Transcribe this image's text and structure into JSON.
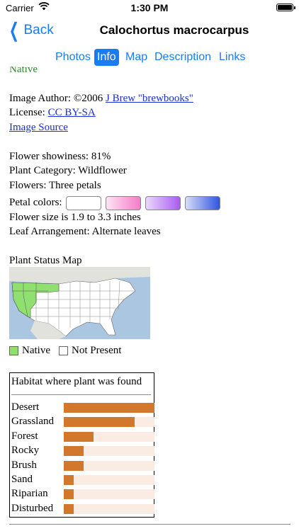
{
  "status_bar": {
    "carrier": "Carrier",
    "time": "1:30 PM"
  },
  "nav": {
    "back_label": "Back",
    "title": "Calochortus macrocarpus"
  },
  "tabs": [
    {
      "label": "Photos",
      "active": false
    },
    {
      "label": "Info",
      "active": true
    },
    {
      "label": "Map",
      "active": false
    },
    {
      "label": "Description",
      "active": false
    },
    {
      "label": "Links",
      "active": false
    }
  ],
  "info": {
    "native_partial": "Native",
    "author_label": "Image Author: ",
    "author_year": "©2006 ",
    "author_link": "J Brew \"brewbooks\"",
    "license_label": "License: ",
    "license_link": "CC BY-SA",
    "image_source": "Image Source",
    "showiness": "Flower showiness: 81%",
    "category": "Plant Category: Wildflower",
    "flowers": "Flowers: Three petals",
    "petal_colors_label": "Petal colors:",
    "petal_colors": [
      "#ffffff",
      "#f58fd0",
      "#b873f2",
      "#4a6ee6"
    ],
    "flower_size": "Flower size is 1.9 to 3.3 inches",
    "leaf_arrangement": "Leaf Arrangement: Alternate leaves"
  },
  "status_map": {
    "title": "Plant Status Map",
    "legend_native": "Native",
    "legend_not_present": "Not Present",
    "native_color": "#90e070",
    "not_present_color": "#ffffff"
  },
  "habitat": {
    "title": "Habitat where plant was found",
    "bar_color": "#d2782d",
    "track_color": "#fbece3",
    "items": [
      {
        "label": "Desert",
        "fraction": 1.0
      },
      {
        "label": "Grassland",
        "fraction": 0.78
      },
      {
        "label": "Forest",
        "fraction": 0.33
      },
      {
        "label": "Rocky",
        "fraction": 0.22
      },
      {
        "label": "Brush",
        "fraction": 0.22
      },
      {
        "label": "Sand",
        "fraction": 0.11
      },
      {
        "label": "Riparian",
        "fraction": 0.11
      },
      {
        "label": "Disturbed",
        "fraction": 0.11
      }
    ]
  }
}
